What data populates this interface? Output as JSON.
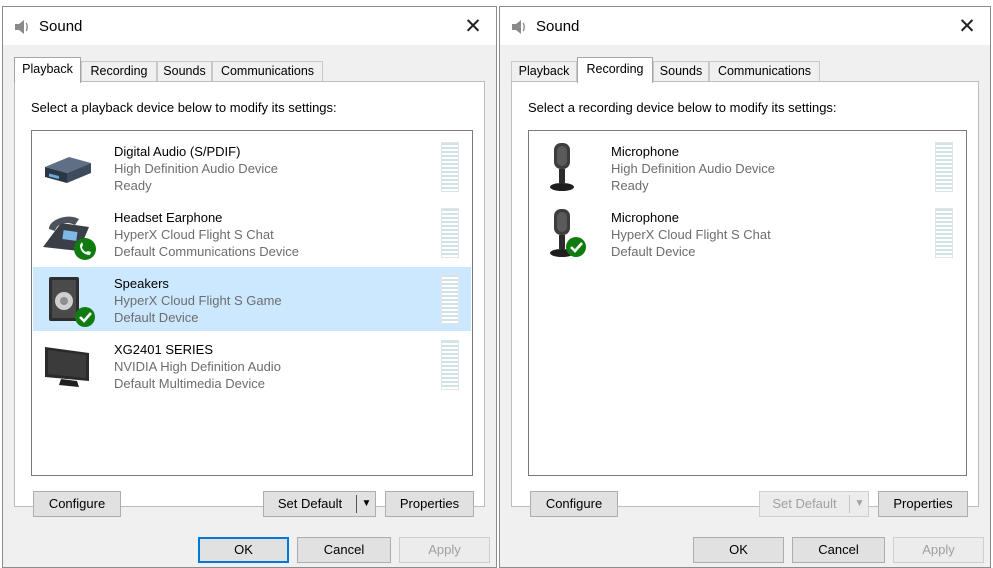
{
  "left": {
    "title": "Sound",
    "close_glyph": "✕",
    "tabs": [
      "Playback",
      "Recording",
      "Sounds",
      "Communications"
    ],
    "active_tab": "Playback",
    "instruction": "Select a playback device below to modify its settings:",
    "devices": [
      {
        "name": "Digital Audio (S/PDIF)",
        "sub": "High Definition Audio Device",
        "status": "Ready",
        "icon": "spdif-box-icon",
        "selected": false,
        "default_badge": false
      },
      {
        "name": "Headset Earphone",
        "sub": "HyperX Cloud Flight S Chat",
        "status": "Default Communications Device",
        "icon": "desk-phone-icon",
        "selected": false,
        "default_badge": true
      },
      {
        "name": "Speakers",
        "sub": "HyperX Cloud Flight S Game",
        "status": "Default Device",
        "icon": "speaker-icon",
        "selected": true,
        "default_badge": true
      },
      {
        "name": "XG2401 SERIES",
        "sub": "NVIDIA High Definition Audio",
        "status": "Default Multimedia Device",
        "icon": "monitor-icon",
        "selected": false,
        "default_badge": false
      }
    ],
    "buttons": {
      "configure": "Configure",
      "set_default": "Set Default",
      "set_default_arrow": "▼",
      "properties": "Properties",
      "ok": "OK",
      "cancel": "Cancel",
      "apply": "Apply"
    },
    "set_default_enabled": true
  },
  "right": {
    "title": "Sound",
    "close_glyph": "✕",
    "tabs": [
      "Playback",
      "Recording",
      "Sounds",
      "Communications"
    ],
    "active_tab": "Recording",
    "instruction": "Select a recording device below to modify its settings:",
    "devices": [
      {
        "name": "Microphone",
        "sub": "High Definition Audio Device",
        "status": "Ready",
        "icon": "microphone-icon",
        "selected": false,
        "default_badge": false
      },
      {
        "name": "Microphone",
        "sub": "HyperX Cloud Flight S Chat",
        "status": "Default Device",
        "icon": "microphone-icon",
        "selected": false,
        "default_badge": true
      }
    ],
    "buttons": {
      "configure": "Configure",
      "set_default": "Set Default",
      "set_default_arrow": "▼",
      "properties": "Properties",
      "ok": "OK",
      "cancel": "Cancel",
      "apply": "Apply"
    },
    "set_default_enabled": false
  },
  "colors": {
    "selected_row": "#cce8ff",
    "default_check": "#107c10",
    "focus_border": "#0078d7"
  }
}
